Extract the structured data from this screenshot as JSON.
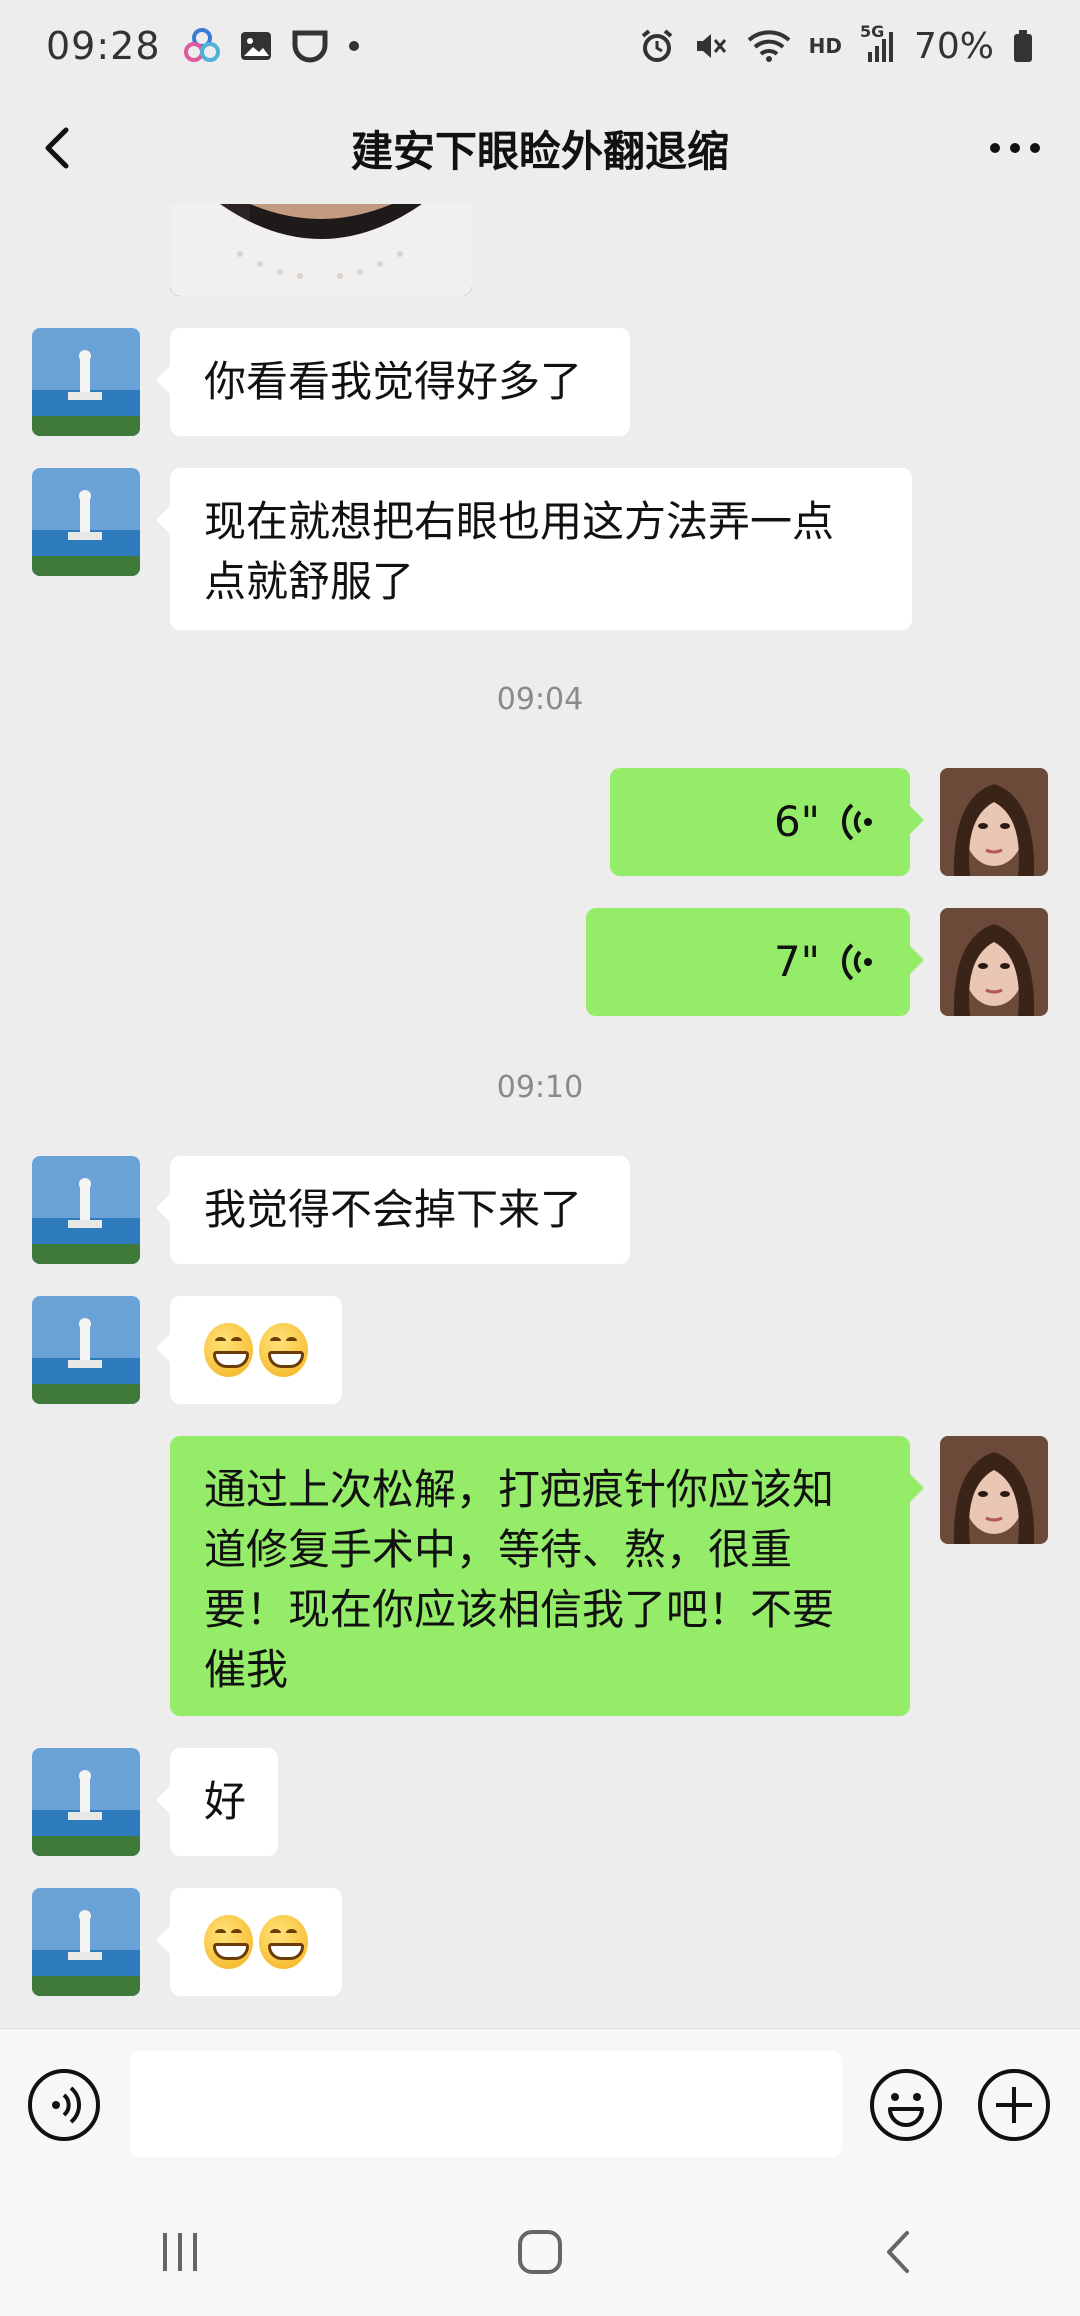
{
  "status_bar": {
    "time": "09:28",
    "network": "HD",
    "signal": "5G",
    "battery": "70%"
  },
  "header": {
    "title": "建安下眼睑外翻退缩"
  },
  "messages": [
    {
      "type": "text",
      "side": "in",
      "text": "你看看我觉得好多了"
    },
    {
      "type": "text",
      "side": "in",
      "lines": [
        "现在就想把右眼也用这方法弄一点",
        "点就舒服了"
      ]
    },
    {
      "type": "time",
      "text": "09:04"
    },
    {
      "type": "voice",
      "side": "out",
      "duration": "6\""
    },
    {
      "type": "voice",
      "side": "out",
      "duration": "7\""
    },
    {
      "type": "time",
      "text": "09:10"
    },
    {
      "type": "text",
      "side": "in",
      "text": "我觉得不会掉下来了"
    },
    {
      "type": "emoji",
      "side": "in",
      "icons": [
        "grin-emoji",
        "grin-emoji"
      ]
    },
    {
      "type": "text",
      "side": "out",
      "lines": [
        "通过上次松解，打疤痕针你应该知",
        "道修复手术中，等待、熬，很重",
        "要！现在你应该相信我了吧！不要",
        "催我"
      ]
    },
    {
      "type": "text",
      "side": "in",
      "text": "好"
    },
    {
      "type": "emoji",
      "side": "in",
      "icons": [
        "grin-emoji",
        "grin-emoji"
      ]
    }
  ],
  "colors": {
    "background": "#ededed",
    "outgoing_bubble": "#95ec69",
    "incoming_bubble": "#ffffff",
    "timestamp": "#8a8a8a"
  },
  "icons": {
    "status_notifications": [
      "pinwheel-icon",
      "gallery-icon",
      "shield-icon",
      "dot-icon"
    ],
    "status_right": [
      "alarm-icon",
      "mute-icon",
      "wifi-icon",
      "signal-icon",
      "battery-icon"
    ],
    "input": [
      "voice-mode-icon",
      "emoji-icon",
      "plus-icon"
    ],
    "nav": [
      "recents-icon",
      "home-icon",
      "back-icon"
    ]
  }
}
